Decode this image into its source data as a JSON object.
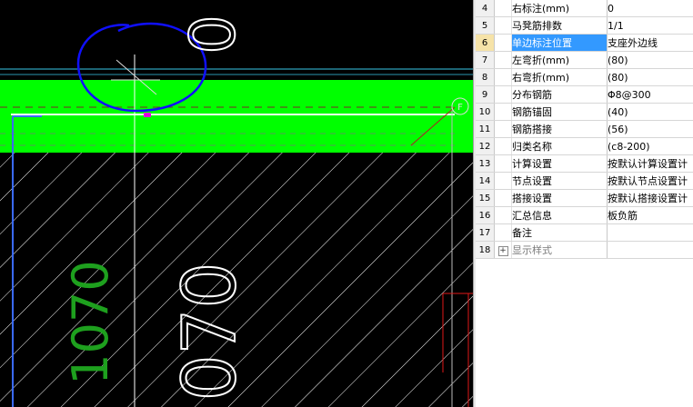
{
  "canvas": {
    "labels": {
      "top_dimension": "0",
      "vertical_green_dimension": "1070",
      "vertical_white_dimension": "070",
      "end_marker": "F"
    },
    "colors": {
      "background": "#000000",
      "slab_band": "#00ff00",
      "hatch": "#ffffff",
      "green_text": "#1ea01e",
      "blue_ring": "#1010ff",
      "cyan_line": "#38c8e8",
      "red_line": "#e01818",
      "magenta_mark": "#e000e0"
    }
  },
  "properties": {
    "rows": [
      {
        "num": "4",
        "name": "右标注(mm)",
        "value": "0"
      },
      {
        "num": "5",
        "name": "马凳筋排数",
        "value": "1/1"
      },
      {
        "num": "6",
        "name": "单边标注位置",
        "value": "支座外边线",
        "selected": true
      },
      {
        "num": "7",
        "name": "左弯折(mm)",
        "value": "(80)"
      },
      {
        "num": "8",
        "name": "右弯折(mm)",
        "value": "(80)"
      },
      {
        "num": "9",
        "name": "分布钢筋",
        "value": "Φ8@300"
      },
      {
        "num": "10",
        "name": "钢筋锚固",
        "value": "(40)"
      },
      {
        "num": "11",
        "name": "钢筋搭接",
        "value": "(56)"
      },
      {
        "num": "12",
        "name": "归类名称",
        "value": "(c8-200)"
      },
      {
        "num": "13",
        "name": "计算设置",
        "value": "按默认计算设置计"
      },
      {
        "num": "14",
        "name": "节点设置",
        "value": "按默认节点设置计"
      },
      {
        "num": "15",
        "name": "搭接设置",
        "value": "按默认搭接设置计"
      },
      {
        "num": "16",
        "name": "汇总信息",
        "value": "板负筋"
      },
      {
        "num": "17",
        "name": "备注",
        "value": ""
      },
      {
        "num": "18",
        "name": "显示样式",
        "value": "",
        "expander": "+",
        "grey": true
      }
    ]
  }
}
